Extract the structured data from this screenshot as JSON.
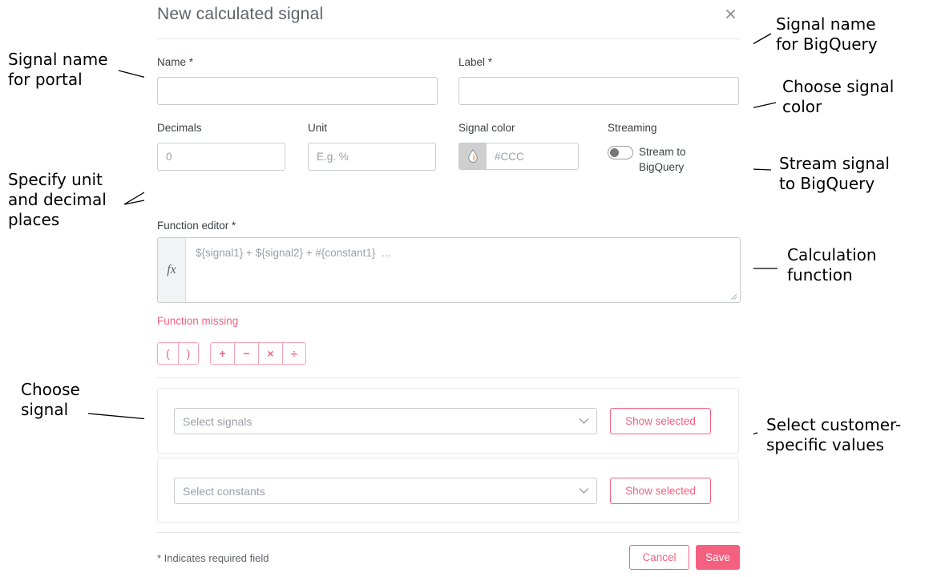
{
  "dialog": {
    "title": "New calculated signal",
    "close_icon": "close-icon",
    "fields": {
      "name_label": "Name *",
      "name_value": "",
      "name_placeholder": "",
      "label_label": "Label *",
      "label_value": "",
      "label_placeholder": "",
      "decimals_label": "Decimals",
      "decimals_value": "",
      "decimals_placeholder": "0",
      "unit_label": "Unit",
      "unit_value": "",
      "unit_placeholder": "E.g. %",
      "signal_color_label": "Signal color",
      "signal_color_value": "",
      "signal_color_placeholder": "#CCC",
      "signal_color_swatch_icon": "water-drop-icon",
      "streaming_label": "Streaming",
      "streaming_toggle_label": "Stream to BigQuery",
      "streaming_toggle_state": "off",
      "function_editor_label": "Function editor *",
      "function_editor_prefix": "fx",
      "function_editor_value": "",
      "function_editor_placeholder": "${signal1} + ${signal2} + #{constant1}  ...",
      "function_error": "Function missing"
    },
    "operators": {
      "paren_group": [
        "(",
        ")"
      ],
      "math_group": [
        "+",
        "−",
        "×",
        "÷"
      ]
    },
    "selectors": [
      {
        "placeholder": "Select signals",
        "value": "",
        "chevron_icon": "chevron-down-icon",
        "action_label": "Show selected"
      },
      {
        "placeholder": "Select constants",
        "value": "",
        "chevron_icon": "chevron-down-icon",
        "action_label": "Show selected"
      }
    ],
    "footer": {
      "required_note": "* Indicates required field",
      "cancel_label": "Cancel",
      "save_label": "Save"
    },
    "colors": {
      "accent": "#F4607F",
      "error": "#F4607F",
      "swatch": "#CFCFCF",
      "border": "#C9CCCF"
    }
  },
  "annotations": [
    {
      "id": "signal-name-for-portal",
      "text": "Signal name\nfor portal"
    },
    {
      "id": "specify-unit-decimals",
      "text": "Specify unit\nand decimal\nplaces"
    },
    {
      "id": "choose-signal",
      "text": "Choose\nsignal"
    },
    {
      "id": "signal-name-for-bigquery",
      "text": "Signal name\nfor BigQuery"
    },
    {
      "id": "choose-signal-color",
      "text": "Choose signal\ncolor"
    },
    {
      "id": "stream-signal-bigquery",
      "text": "Stream signal\nto BigQuery"
    },
    {
      "id": "calculation-function",
      "text": "Calculation\nfunction"
    },
    {
      "id": "select-customer-values",
      "text": "Select customer-\nspecific values"
    }
  ]
}
